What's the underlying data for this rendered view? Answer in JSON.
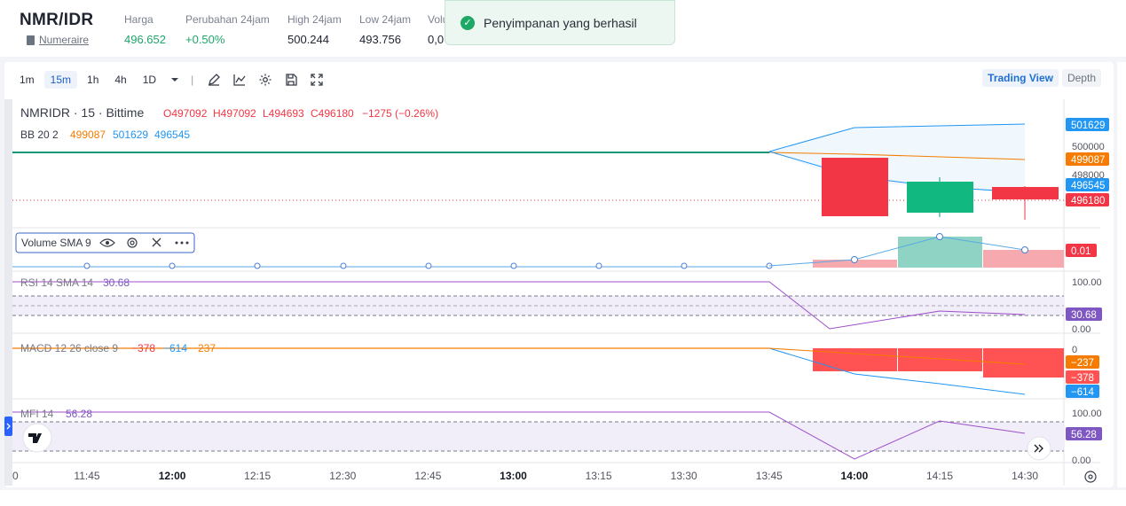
{
  "header": {
    "pair": "NMR/IDR",
    "coin_name": "Numeraire",
    "stats": [
      {
        "label": "Harga",
        "value": "496.652",
        "color": "#1fa56a"
      },
      {
        "label": "Perubahan 24jam",
        "value": "+0.50%",
        "color": "#1fa56a"
      },
      {
        "label": "High 24jam",
        "value": "500.244",
        "color": "#1e2330"
      },
      {
        "label": "Low 24jam",
        "value": "493.756",
        "color": "#1e2330"
      },
      {
        "label": "Volu",
        "value": "0,0",
        "color": "#1e2330"
      }
    ]
  },
  "toast": {
    "message": "Penyimpanan yang berhasil"
  },
  "toolbar": {
    "timeframes": [
      "1m",
      "15m",
      "1h",
      "4h",
      "1D"
    ],
    "active_timeframe": "15m",
    "views": [
      "Trading View",
      "Depth"
    ],
    "active_view": "Trading View"
  },
  "chart_data": {
    "type": "candlestick",
    "title": "NMRIDR · 15 · Bittime",
    "ohlc_legend": {
      "o": "O497092",
      "h": "H497092",
      "l": "L494693",
      "c": "C496180",
      "change": "−1275 (−0.26%)"
    },
    "bb_legend": {
      "name": "BB 20 2",
      "values": [
        "499087",
        "501629",
        "496545"
      ]
    },
    "x_ticks": [
      "11:45",
      "12:00",
      "12:15",
      "12:30",
      "12:45",
      "13:00",
      "13:15",
      "13:30",
      "13:45",
      "14:00",
      "14:15",
      "14:30"
    ],
    "bold_ticks": [
      "12:00",
      "13:00",
      "14:00"
    ],
    "price_ticks": [
      "500000",
      "498000"
    ],
    "price_labels": [
      {
        "value": 501629,
        "text": "501629",
        "color": "#2196f3"
      },
      {
        "value": 499087,
        "text": "499087",
        "color": "#f57c00"
      },
      {
        "value": 496545,
        "text": "496545",
        "color": "#2196f3"
      },
      {
        "value": 496180,
        "text": "496180",
        "color": "#f23645"
      }
    ],
    "candles": [
      {
        "time": "13:45",
        "open": 497100,
        "high": 497100,
        "low": 497100,
        "close": 497100
      },
      {
        "time": "14:00",
        "open": 497500,
        "high": 497500,
        "low": 494300,
        "close": 494300
      },
      {
        "time": "14:15",
        "open": 494700,
        "high": 497100,
        "low": 494100,
        "close": 496400
      },
      {
        "time": "14:30",
        "open": 497092,
        "high": 497092,
        "low": 494693,
        "close": 496180
      }
    ],
    "volume": {
      "legend": "Volume SMA 9",
      "last_label": "0.01"
    },
    "rsi": {
      "legend": "RSI 14 SMA 14",
      "value": "30.68",
      "ticks": [
        "100.00",
        "0.00"
      ]
    },
    "macd": {
      "legend": "MACD 12 26 close 9",
      "values": [
        "−378",
        "−614",
        "−237"
      ],
      "zero_tick": "0",
      "labels": [
        "−237",
        "−378",
        "−614"
      ]
    },
    "mfi": {
      "legend": "MFI 14",
      "value": "56.28",
      "ticks": [
        "100.00",
        "0.00"
      ]
    }
  }
}
